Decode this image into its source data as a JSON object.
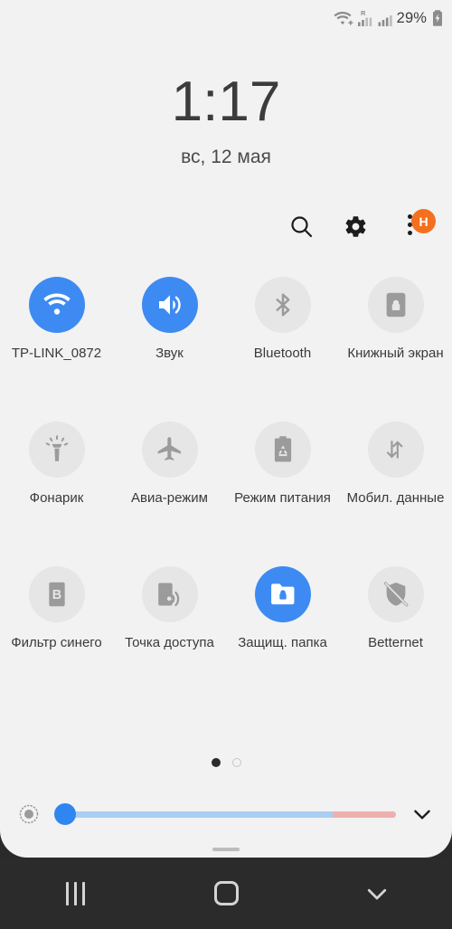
{
  "statusbar": {
    "wifi_icon": "wifi-plus-icon",
    "roaming_label": "R",
    "signal_icon_1": "signal-bars-roaming-icon",
    "signal_icon_2": "signal-bars-icon",
    "battery_percent": "29%",
    "battery_icon": "battery-charging-icon"
  },
  "clock": {
    "time": "1:17",
    "date": "вс, 12 мая"
  },
  "actions": {
    "search_icon": "search-icon",
    "settings_icon": "gear-icon",
    "overflow_icon": "overflow-menu-icon",
    "avatar_initial": "H",
    "avatar_color": "#f4701f"
  },
  "theme": {
    "panel_background": "#f2f2f2",
    "tile_on_color": "#3d8bf2",
    "tile_off_color": "#e6e6e6",
    "navbar_color": "#2b2b2b",
    "slider_track_color": "#a9cef5",
    "slider_red_color": "#eeb0ae",
    "slider_thumb_color": "#2f86f0"
  },
  "tiles": [
    {
      "label": "TP-LINK_0872",
      "icon": "wifi-icon",
      "state": "on"
    },
    {
      "label": "Звук",
      "icon": "volume-icon",
      "state": "on"
    },
    {
      "label": "Bluetooth",
      "icon": "bluetooth-icon",
      "state": "off"
    },
    {
      "label": "Книжный экран",
      "icon": "portrait-lock-icon",
      "state": "off"
    },
    {
      "label": "Фонарик",
      "icon": "flashlight-icon",
      "state": "off"
    },
    {
      "label": "Авиа-режим",
      "icon": "airplane-icon",
      "state": "off"
    },
    {
      "label": "Режим питания",
      "icon": "power-saving-icon",
      "state": "off"
    },
    {
      "label": "Мобил. данные",
      "icon": "mobile-data-icon",
      "state": "off"
    },
    {
      "label": "Фильтр синего",
      "icon": "blue-light-filter-icon",
      "state": "off"
    },
    {
      "label": "Точка доступа",
      "icon": "hotspot-icon",
      "state": "off"
    },
    {
      "label": "Защищ. папка",
      "icon": "secure-folder-icon",
      "state": "on"
    },
    {
      "label": "Betternet",
      "icon": "shield-off-icon",
      "state": "off"
    }
  ],
  "pages": {
    "total": 2,
    "current": 1
  },
  "brightness": {
    "sun_icon": "brightness-icon",
    "value_percent": 4,
    "expand_icon": "chevron-down-icon"
  },
  "navbar": {
    "recents_icon": "recents-icon",
    "home_icon": "home-icon",
    "back_icon": "collapse-chevron-icon"
  }
}
